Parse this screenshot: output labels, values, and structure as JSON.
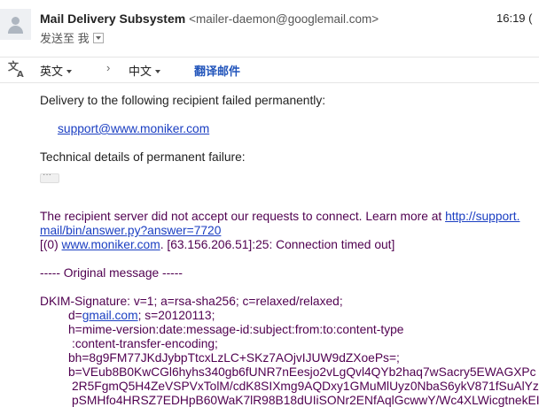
{
  "sender": {
    "name": "Mail Delivery Subsystem",
    "email": "<mailer-daemon@googlemail.com>",
    "time": "16:19 ("
  },
  "recipient_line": {
    "to_label": "发送至 我"
  },
  "translate_bar": {
    "from_lang": "英文",
    "arrow": "›",
    "to_lang": "中文",
    "action": "翻译邮件"
  },
  "body": {
    "intro": "Delivery to the following recipient failed permanently:",
    "recipient": "support@www.moniker.com",
    "details_heading": "Technical details of permanent failure:",
    "ellipsis": "···",
    "server_msg": "The recipient server did not accept our requests to connect. Learn more at ",
    "server_link_start": "http://support.",
    "server_link_end": "mail/bin/answer.py?answer=7720",
    "conn_prefix": "[(0) ",
    "conn_link": "www.moniker.com",
    "conn_suffix": ". [63.156.206.51]:25: Connection timed out]",
    "original_header": "----- Original message -----",
    "dkim_lines": [
      "DKIM-Signature: v=1; a=rsa-sha256; c=relaxed/relaxed;",
      "d=",
      "h=mime-version:date:message-id:subject:from:to:content-type",
      ":content-transfer-encoding;",
      "bh=8g9FM77JKdJybpTtcxLzLC+SKz7AOjvIJUW9dZXoePs=;",
      "b=VEub8B0KwCGl6hyhs340gb6fUNR7nEesjo2vLgQvl4QYb2haq7wSacry5EWAGXPc",
      "2R5FgmQ5H4ZeVSPVxTolM/cdK8SIXmg9AQDxy1GMuMlUyz0NbaS6ykV871fSuAlYz6",
      "pSMHfo4HRSZ7EDHpB60WaK7lR98B18dUIiSONr2ENfAqlGcwwY/Wc4XLWicgtnekEI"
    ],
    "dkim_d_link": "gmail.com",
    "dkim_d_suffix": "; s=20120113;"
  }
}
